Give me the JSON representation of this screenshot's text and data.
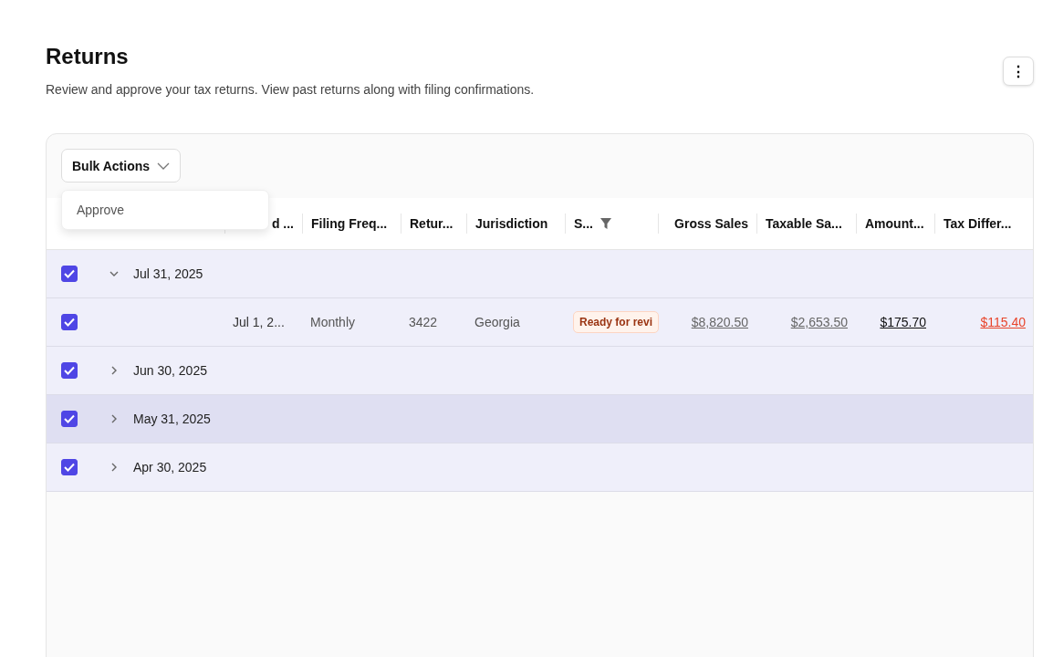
{
  "page": {
    "title": "Returns",
    "description": "Review and approve your tax returns. View past returns along with filing confirmations.",
    "menu_button": "⋮"
  },
  "toolbar": {
    "bulk_actions": "Bulk Actions",
    "menu": {
      "open": true,
      "items": [
        "Approve"
      ]
    }
  },
  "table": {
    "columns": [
      {
        "label": "d ..."
      },
      {
        "label": "Filing Freq..."
      },
      {
        "label": "Retur..."
      },
      {
        "label": "Jurisdiction"
      },
      {
        "label": "S...",
        "filter": true
      },
      {
        "label": "Gross Sales"
      },
      {
        "label": "Taxable Sa..."
      },
      {
        "label": "Amount..."
      },
      {
        "label": "Tax Differ..."
      }
    ],
    "rows": [
      {
        "kind": "group",
        "checked": true,
        "expanded": true,
        "highlighted": false,
        "date": "Jul 31, 2025"
      },
      {
        "kind": "detail",
        "checked": true,
        "highlighted": false,
        "period": "Jul 1, 2...",
        "frequency": "Monthly",
        "return": "3422",
        "jurisdiction": "Georgia",
        "status": "Ready for revi",
        "gross_sales": "$8,820.50",
        "taxable_sales": "$2,653.50",
        "amount": "$175.70",
        "tax_difference": "$115.40"
      },
      {
        "kind": "group",
        "checked": true,
        "expanded": false,
        "highlighted": false,
        "date": "Jun 30, 2025"
      },
      {
        "kind": "group",
        "checked": true,
        "expanded": false,
        "highlighted": true,
        "date": "May 31, 2025"
      },
      {
        "kind": "group",
        "checked": true,
        "expanded": false,
        "highlighted": false,
        "date": "Apr 30, 2025"
      }
    ]
  }
}
